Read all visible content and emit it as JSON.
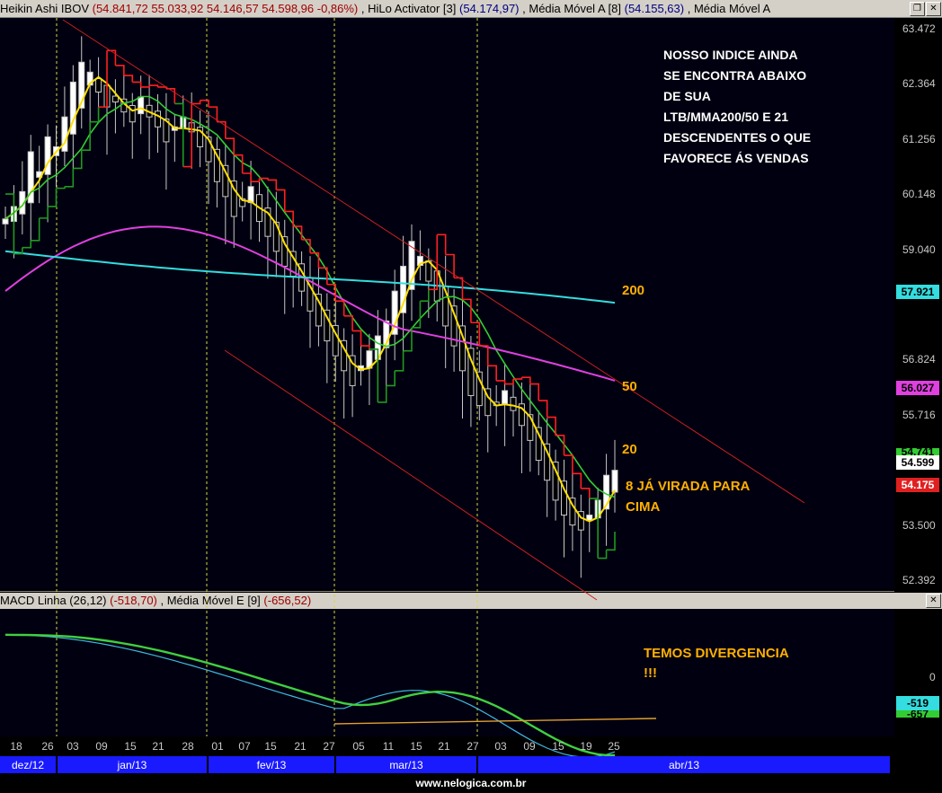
{
  "window": {
    "title_prefix": "Heikin Ashi IBOV",
    "title_values": "(54.841,72  55.033,92  54.146,57  54.598,96  -0,86%)",
    "hilo_label": ", HiLo Activator [3]",
    "hilo_value": "(54.174,97)",
    "mma_label": ", Média Móvel A [8]",
    "mma_value": "(54.155,63)",
    "mma2_label": ", Média Móvel A",
    "btn_restore": "❐",
    "btn_close": "✕"
  },
  "macd_header": {
    "label1": "MACD Linha (26,12)",
    "value1": "(-518,70)",
    "label2": ", Média Móvel E [9]",
    "value2": "(-656,52)"
  },
  "annotations": {
    "main_text": [
      "NOSSO INDICE AINDA",
      "SE ENCONTRA ABAIXO",
      "DE SUA",
      "LTB/MMA200/50 E 21",
      "DESCENDENTES O QUE",
      "FAVORECE ÁS VENDAS"
    ],
    "label_200": "200",
    "label_50": "50",
    "label_20": "20",
    "label_8": [
      "8 JÁ VIRADA PARA",
      "CIMA"
    ],
    "macd_text": [
      "TEMOS DIVERGENCIA",
      "!!!"
    ]
  },
  "price_tags": {
    "ma200": "57.921",
    "ma50": "56.027",
    "ma20": "54.741",
    "close": "54.599",
    "hilo": "54.175",
    "macd": "-519",
    "macd_signal": "-657",
    "macd_zero": "0"
  },
  "footer": "www.nelogica.com.br",
  "colors": {
    "bull": "#ffffff",
    "bear": "#000000",
    "hilo_up": "#1f9a1f",
    "hilo_down": "#ff2020",
    "ma8": "#ffe000",
    "ma20": "#33cc33",
    "ma50": "#e040e0",
    "ma200": "#33dde0",
    "trendline": "#cc2020",
    "macd": "#40b8e0",
    "signal": "#40d040"
  },
  "chart_data": [
    {
      "type": "candlestick",
      "title": "Heikin Ashi IBOV",
      "y_ticks": [
        "63.472",
        "62.364",
        "61.256",
        "60.148",
        "59.040",
        "56.824",
        "55.716",
        "53.500",
        "52.392"
      ],
      "ylim": [
        52392,
        63472
      ],
      "x_ticks": [
        "18",
        "26",
        "03",
        "09",
        "15",
        "21",
        "28",
        "01",
        "07",
        "15",
        "21",
        "27",
        "05",
        "11",
        "15",
        "21",
        "27",
        "03",
        "09",
        "15",
        "19",
        "25"
      ],
      "months": [
        "dez/12",
        "jan/13",
        "fev/13",
        "mar/13",
        "abr/13"
      ],
      "series": [
        {
          "name": "Média Móvel A [8]",
          "last": 54155.63
        },
        {
          "name": "HiLo Activator [3]",
          "last": 54174.97
        },
        {
          "name": "200",
          "last": 57921
        },
        {
          "name": "50",
          "last": 56027
        },
        {
          "name": "20",
          "last": 54741
        }
      ],
      "candles_close": [
        59650,
        59900,
        60200,
        61000,
        60600,
        61300,
        61100,
        61700,
        62400,
        62800,
        62600,
        62200,
        61900,
        62000,
        61800,
        61600,
        62100,
        61700,
        61500,
        61200,
        61500,
        61700,
        61400,
        61100,
        60800,
        60400,
        60100,
        59700,
        59900,
        60300,
        59600,
        59300,
        59000,
        58700,
        58500,
        58200,
        57800,
        57500,
        57200,
        56900,
        56600,
        56300,
        56700,
        57000,
        57300,
        57600,
        58200,
        58700,
        59200,
        58900,
        58400,
        58000,
        57500,
        57100,
        56600,
        56100,
        55900,
        55700,
        55900,
        56200,
        55800,
        55500,
        55200,
        54800,
        54400,
        54000,
        53700,
        53500,
        53400,
        53700,
        54000,
        54500,
        54600
      ]
    },
    {
      "type": "line",
      "title": "MACD Linha (26,12)",
      "series": [
        {
          "name": "MACD Linha (26,12)",
          "last": -518.7
        },
        {
          "name": "Média Móvel E [9]",
          "last": -656.52
        }
      ]
    }
  ]
}
